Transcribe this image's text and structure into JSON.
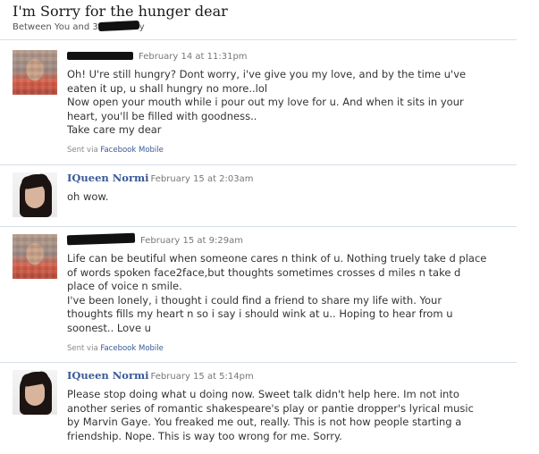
{
  "thread": {
    "title": "I'm Sorry for the hunger dear",
    "participants_prefix": "Between You and 3",
    "participants_suffix": "y"
  },
  "messages": [
    {
      "author": "",
      "time": "February 14 at 11:31pm",
      "lines": [
        "Oh! U're still hungry? Dont worry, i've give you my love, and by the time u've eaten it up, u shall hungry no more..lol",
        "Now open your mouth while i pour out my love for u. And when it sits in your heart, you'll be filled with goodness..",
        "Take care my dear"
      ],
      "sent_prefix": "Sent via",
      "sent_link": "Facebook Mobile"
    },
    {
      "author": "IQueen Normi",
      "time": "February 15 at 2:03am",
      "lines": [
        "oh wow."
      ]
    },
    {
      "author": "",
      "time": "February 15 at 9:29am",
      "lines": [
        "Life can be beutiful when someone cares n think of u. Nothing truely take d place of words spoken face2face,but thoughts sometimes crosses d miles n take d place of voice n smile.",
        "I've been lonely, i thought i could find a friend to share my life with. Your thoughts fills my heart n so i say i should wink at u.. Hoping to hear from u soonest.. Love u"
      ],
      "sent_prefix": "Sent via",
      "sent_link": "Facebook Mobile"
    },
    {
      "author": "IQueen Normi",
      "time": "February 15 at 5:14pm",
      "lines": [
        "Please stop doing what u doing now. Sweet talk didn't help here. Im not into another series of romantic shakespeare's play or pantie dropper's lyrical music by Marvin Gaye. You freaked me out, really. This is not how people starting a friendship. Nope. This is way too wrong for me. Sorry."
      ]
    }
  ],
  "icons": {
    "avatar_1": "pixelated-avatar-icon",
    "avatar_2": "normi-avatar-icon"
  },
  "colors": {
    "link": "#3b5998",
    "divider": "#d8dfea",
    "meta": "#777777"
  }
}
